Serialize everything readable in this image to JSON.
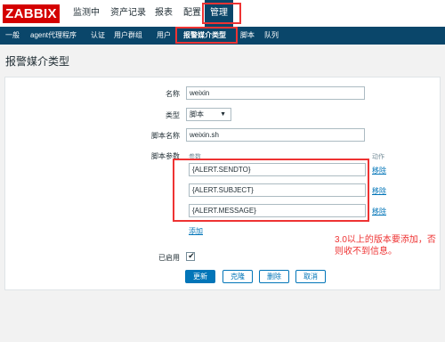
{
  "header": {
    "logo": "ZABBIX",
    "menu": [
      "监测中",
      "资产记录",
      "报表",
      "配置",
      "管理"
    ],
    "active_menu": "管理"
  },
  "subnav": {
    "items": [
      "一般",
      "agent代理程序",
      "认证",
      "用户群组",
      "用户",
      "报警媒介类型",
      "脚本",
      "队列"
    ],
    "active": "报警媒介类型"
  },
  "page": {
    "title": "报警媒介类型"
  },
  "form": {
    "name_label": "名称",
    "name_value": "weixin",
    "type_label": "类型",
    "type_value": "脚本",
    "script_name_label": "脚本名称",
    "script_name_value": "weixin.sh",
    "params_label": "脚本参数",
    "params_header_param": "参数",
    "params_header_action": "动作",
    "params": [
      "{ALERT.SENDTO}",
      "{ALERT.SUBJECT}",
      "{ALERT.MESSAGE}"
    ],
    "remove_label": "移除",
    "add_label": "添加",
    "enabled_label": "已启用",
    "enabled": true
  },
  "buttons": {
    "update": "更新",
    "clone": "克隆",
    "delete": "删除",
    "cancel": "取消"
  },
  "annotation": "3.0以上的版本要添加，否则收不到信息。",
  "colors": {
    "brand": "#d40000",
    "nav": "#0a466a",
    "accent": "#0275b8",
    "highlight": "#ee3333"
  }
}
